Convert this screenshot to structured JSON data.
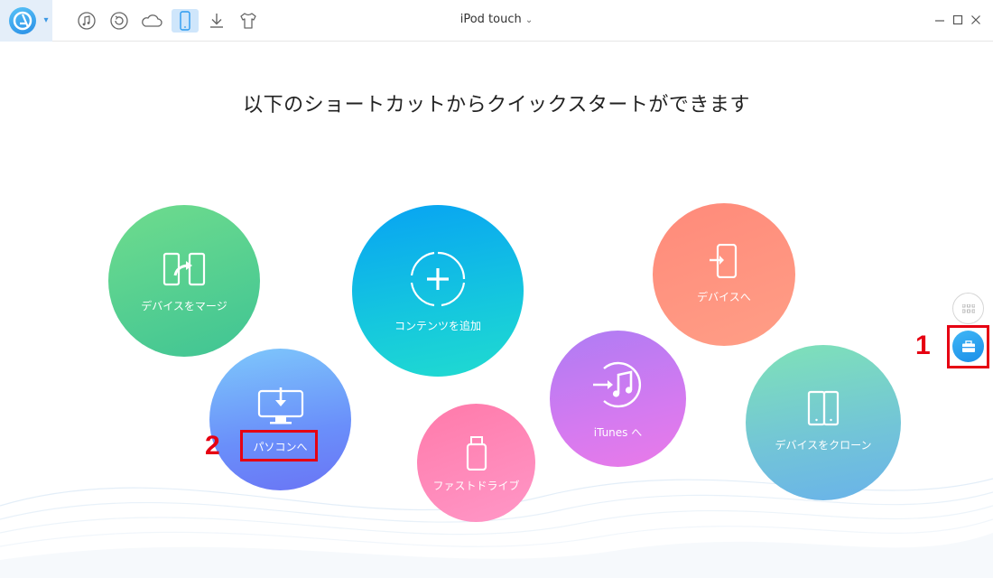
{
  "window": {
    "title": "iPod touch"
  },
  "toolbar": {
    "icons": [
      "music-icon",
      "restore-icon",
      "cloud-icon",
      "device-icon",
      "download-icon",
      "tshirt-icon"
    ]
  },
  "main": {
    "headline": "以下のショートカットからクイックスタートができます",
    "shortcuts": {
      "merge": "デバイスをマージ",
      "add_content": "コンテンツを追加",
      "to_device": "デバイスへ",
      "to_pc": "パソコンへ",
      "fast_drive": "ファストドライブ",
      "to_itunes": "iTunes へ",
      "clone": "デバイスをクローン"
    }
  },
  "annotations": {
    "marker1": "1",
    "marker2": "2"
  },
  "colors": {
    "accent": "#2a9af0",
    "highlight": "#e60012"
  }
}
